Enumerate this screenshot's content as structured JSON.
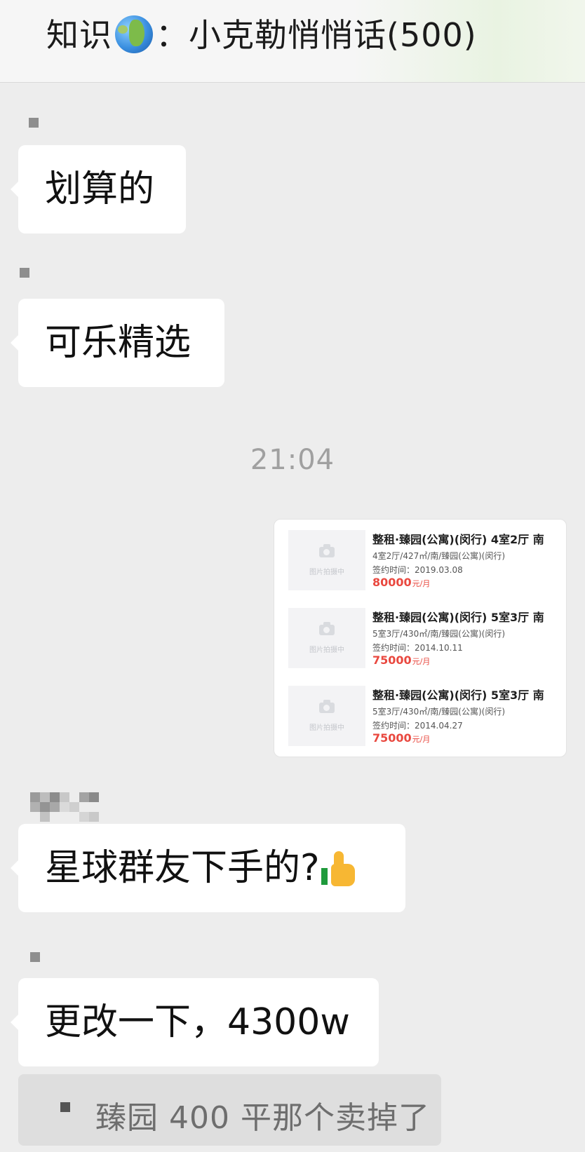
{
  "header": {
    "title_prefix": "知识",
    "globe_icon": "earth-globe-icon",
    "title_suffix": "：小克勒悄悄话(500)"
  },
  "messages": [
    {
      "text": "划算的"
    },
    {
      "text": "可乐精选"
    },
    {
      "text": "星球群友下手的?",
      "emoji": "thumbs-up-icon"
    },
    {
      "text": "更改一下，4300w"
    }
  ],
  "timestamp": "21:04",
  "listing_card": {
    "placeholder_text": "图片拍摄中",
    "items": [
      {
        "title": "整租·臻园(公寓)(闵行) 4室2厅 南",
        "detail": "4室2厅/427㎡/南/臻园(公寓)(闵行)",
        "signed": "签约时间：2019.03.08",
        "price": "80000",
        "unit": "元/月"
      },
      {
        "title": "整租·臻园(公寓)(闵行) 5室3厅 南",
        "detail": "5室3厅/430㎡/南/臻园(公寓)(闵行)",
        "signed": "签约时间：2014.10.11",
        "price": "75000",
        "unit": "元/月"
      },
      {
        "title": "整租·臻园(公寓)(闵行) 5室3厅 南",
        "detail": "5室3厅/430㎡/南/臻园(公寓)(闵行)",
        "signed": "签约时间：2014.04.27",
        "price": "75000",
        "unit": "元/月"
      }
    ]
  },
  "quote": {
    "text": "臻园 400 平那个卖掉了"
  },
  "colors": {
    "background": "#ededed",
    "bubble": "#ffffff",
    "price": "#e9483f",
    "timestamp": "#a0a0a0"
  }
}
